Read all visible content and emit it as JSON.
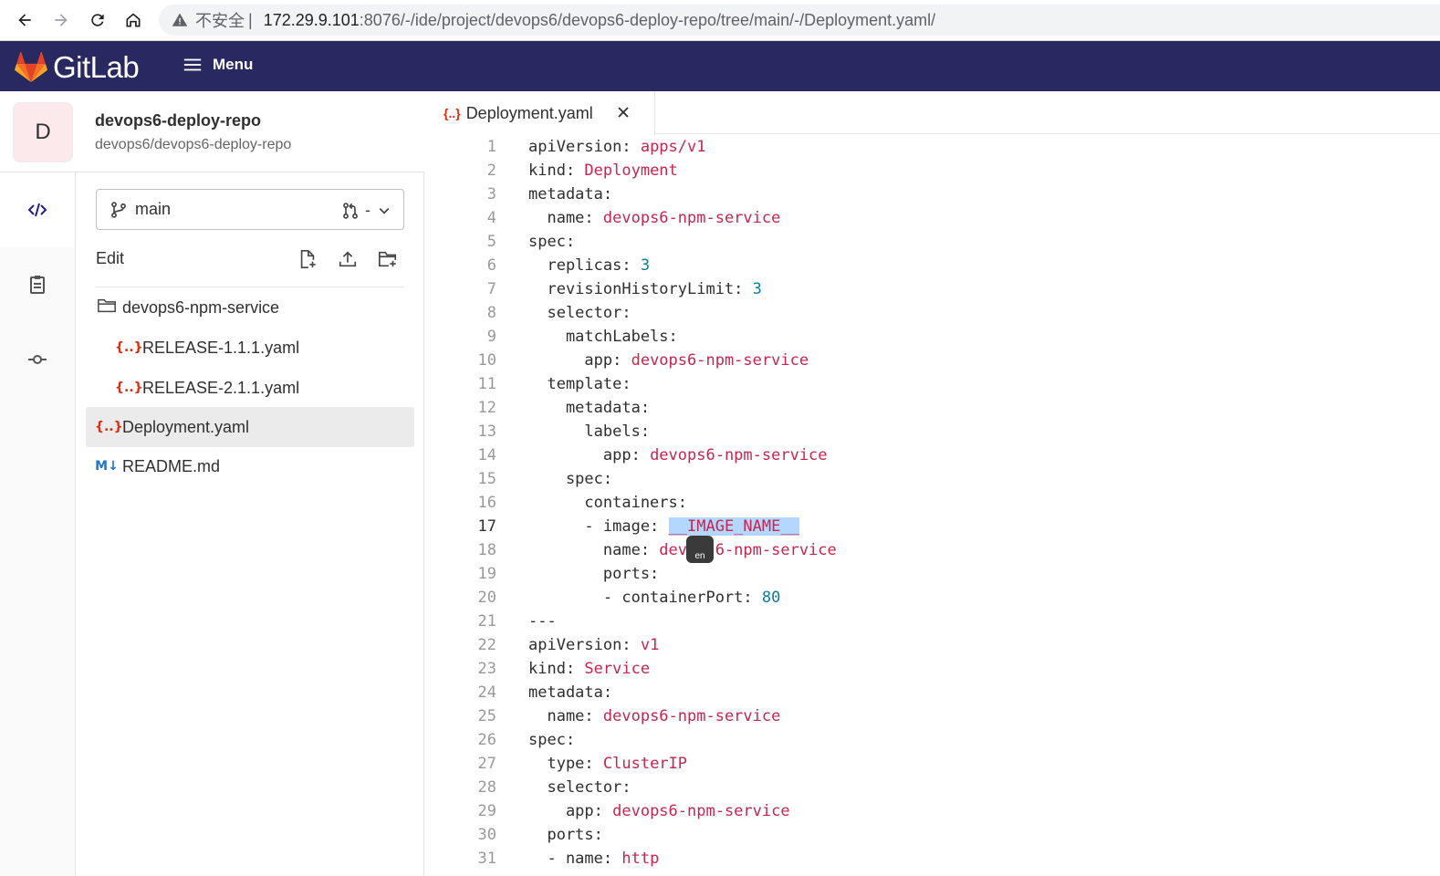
{
  "browser": {
    "insecure_label": "不安全",
    "url_host": "172.29.9.101",
    "url_path": ":8076/-/ide/project/devops6/devops6-deploy-repo/tree/main/-/Deployment.yaml/"
  },
  "header": {
    "brand": "GitLab",
    "menu_label": "Menu"
  },
  "project": {
    "avatar_letter": "D",
    "name": "devops6-deploy-repo",
    "path": "devops6/devops6-deploy-repo"
  },
  "branch": {
    "name": "main",
    "mr_label": "-"
  },
  "tree": {
    "edit_label": "Edit",
    "items": [
      {
        "label": "devops6-npm-service",
        "icon": "folder-icon"
      },
      {
        "label": "RELEASE-1.1.1.yaml",
        "icon": "yaml-file-icon"
      },
      {
        "label": "RELEASE-2.1.1.yaml",
        "icon": "yaml-file-icon"
      },
      {
        "label": "Deployment.yaml",
        "icon": "yaml-file-icon"
      },
      {
        "label": "README.md",
        "icon": "markdown-file-icon"
      }
    ]
  },
  "editor": {
    "tab_label": "Deployment.yaml",
    "active_line": 17,
    "lines": [
      {
        "n": "1",
        "text": "apiVersion: apps/v1"
      },
      {
        "n": "2",
        "text": "kind: Deployment"
      },
      {
        "n": "3",
        "text": "metadata:"
      },
      {
        "n": "4",
        "text": "  name: devops6-npm-service"
      },
      {
        "n": "5",
        "text": "spec:"
      },
      {
        "n": "6",
        "text": "  replicas: 3"
      },
      {
        "n": "7",
        "text": "  revisionHistoryLimit: 3"
      },
      {
        "n": "8",
        "text": "  selector:"
      },
      {
        "n": "9",
        "text": "    matchLabels:"
      },
      {
        "n": "10",
        "text": "      app: devops6-npm-service"
      },
      {
        "n": "11",
        "text": "  template:"
      },
      {
        "n": "12",
        "text": "    metadata:"
      },
      {
        "n": "13",
        "text": "      labels:"
      },
      {
        "n": "14",
        "text": "        app: devops6-npm-service"
      },
      {
        "n": "15",
        "text": "    spec:"
      },
      {
        "n": "16",
        "text": "      containers:"
      },
      {
        "n": "17",
        "text": "      - image: __IMAGE_NAME__"
      },
      {
        "n": "18",
        "text": "        name: devops6-npm-service"
      },
      {
        "n": "19",
        "text": "        ports:"
      },
      {
        "n": "20",
        "text": "        - containerPort: 80"
      },
      {
        "n": "21",
        "text": "---"
      },
      {
        "n": "22",
        "text": "apiVersion: v1"
      },
      {
        "n": "23",
        "text": "kind: Service"
      },
      {
        "n": "24",
        "text": "metadata:"
      },
      {
        "n": "25",
        "text": "  name: devops6-npm-service"
      },
      {
        "n": "26",
        "text": "spec:"
      },
      {
        "n": "27",
        "text": "  type: ClusterIP"
      },
      {
        "n": "28",
        "text": "  selector:"
      },
      {
        "n": "29",
        "text": "    app: devops6-npm-service"
      },
      {
        "n": "30",
        "text": "  ports:"
      },
      {
        "n": "31",
        "text": "  - name: http"
      }
    ],
    "ime_badge": "en"
  }
}
